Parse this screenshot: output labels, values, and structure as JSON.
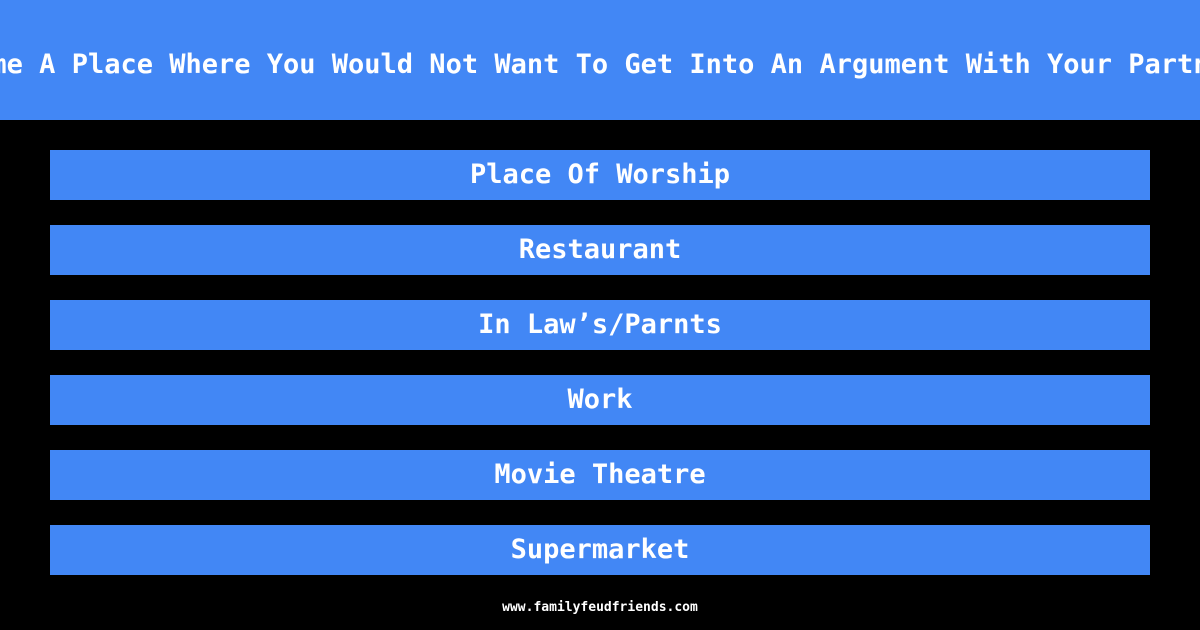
{
  "header": {
    "question": "Name A Place Where You Would Not Want To Get Into An Argument With Your Partner"
  },
  "answers": [
    {
      "label": "Place Of Worship"
    },
    {
      "label": "Restaurant"
    },
    {
      "label": "In Law’s/Parnts"
    },
    {
      "label": "Work"
    },
    {
      "label": "Movie Theatre"
    },
    {
      "label": "Supermarket"
    }
  ],
  "footer": {
    "url": "www.familyfeudfriends.com"
  },
  "colors": {
    "accent": "#4287f5",
    "background": "#000000",
    "text": "#ffffff"
  }
}
